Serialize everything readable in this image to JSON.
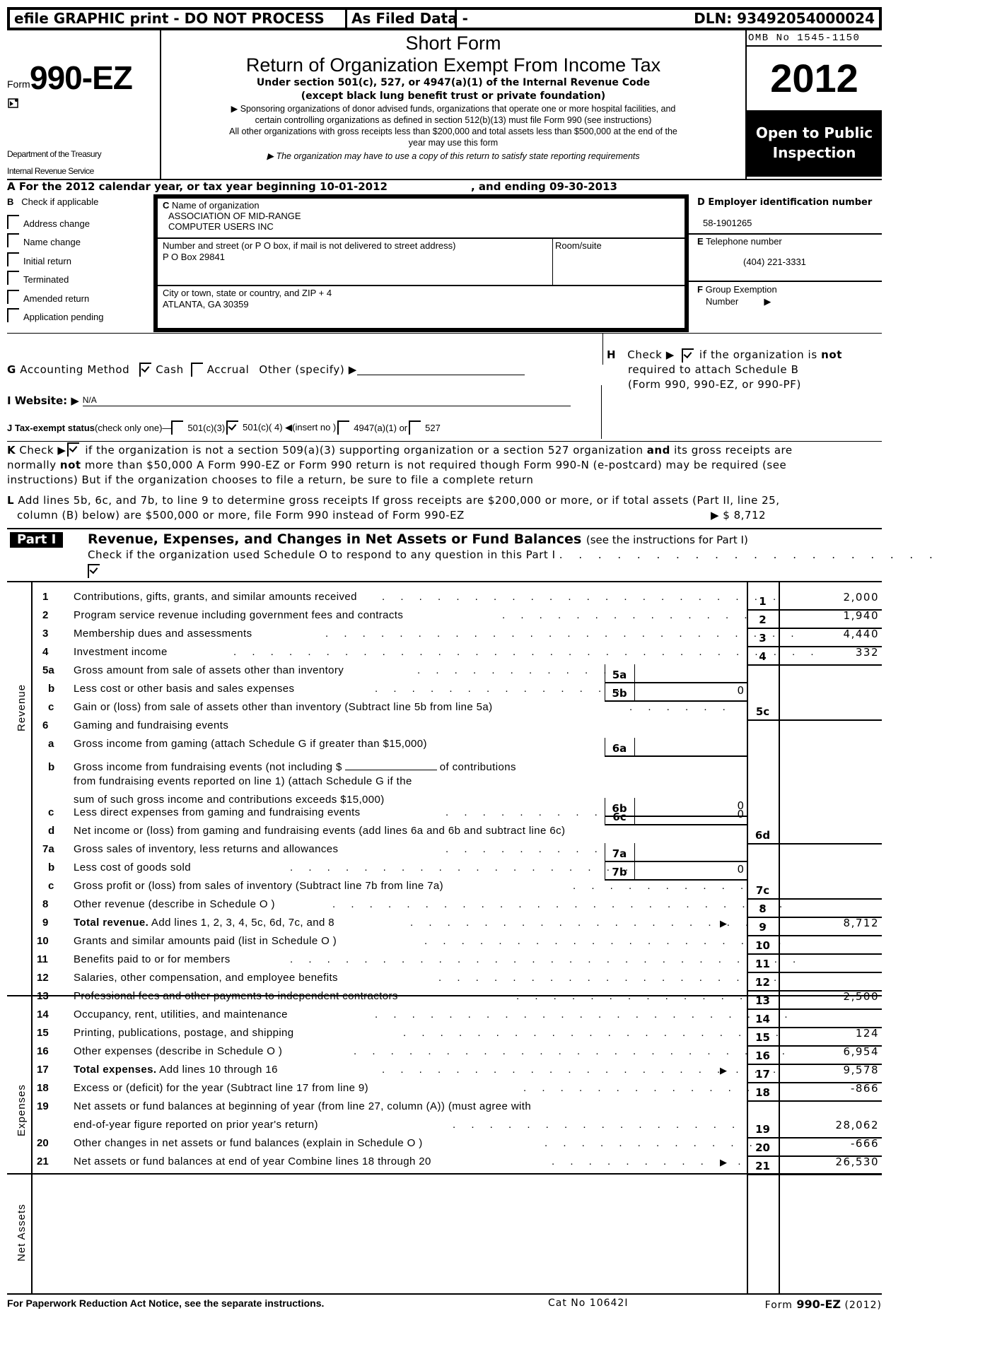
{
  "banner": {
    "efile": "efile GRAPHIC print - DO NOT PROCESS",
    "as_filed": "As Filed Data -",
    "dln": "DLN: 93492054000024"
  },
  "header": {
    "form_word": "Form",
    "form_number": "990-EZ",
    "form_icon": "efile-icon",
    "dept": "Department of the Treasury",
    "irs": "Internal Revenue Service",
    "short_form": "Short Form",
    "title": "Return of Organization Exempt From Income Tax",
    "subtitle1": "Under section 501(c), 527, or 4947(a)(1) of the Internal Revenue Code",
    "subtitle2": "(except black lung benefit trust or private foundation)",
    "note1": "▶ Sponsoring organizations of donor advised funds, organizations that operate one or more hospital facilities, and",
    "note2": "certain controlling organizations as defined in section 512(b)(13) must file Form 990 (see instructions)",
    "note3": "All other organizations with gross receipts less than $200,000 and total assets less than $500,000 at the end of the",
    "note4": "year may use this form",
    "note5": "▶ The organization may have to use a copy of this return to satisfy state reporting requirements",
    "omb": "OMB No 1545-1150",
    "year": "2012",
    "open_public": "Open to Public",
    "inspection": "Inspection"
  },
  "lineA": {
    "text": "A  For the 2012 calendar year, or tax year beginning 10-01-2012",
    "ending": ", and ending 09-30-2013"
  },
  "sectionB": {
    "title_letter": "B",
    "title": "Check if applicable",
    "items": [
      {
        "label": "Address change",
        "checked": false
      },
      {
        "label": "Name change",
        "checked": false
      },
      {
        "label": "Initial return",
        "checked": false
      },
      {
        "label": "Terminated",
        "checked": false
      },
      {
        "label": "Amended return",
        "checked": false
      },
      {
        "label": "Application pending",
        "checked": false
      }
    ]
  },
  "sectionC": {
    "name_label_letter": "C",
    "name_label": "Name of organization",
    "name_line1": "ASSOCIATION OF MID-RANGE",
    "name_line2": "COMPUTER USERS INC",
    "street_label": "Number and street (or P  O  box, if mail is not delivered to street address)",
    "street": "P O Box 29841",
    "room_label": "Room/suite",
    "city_label": "City or town, state or country, and ZIP + 4",
    "city": "ATLANTA, GA  30359"
  },
  "sectionD": {
    "label": "D Employer identification number",
    "ein": "58-1901265"
  },
  "sectionE": {
    "letter": "E",
    "label": "Telephone number",
    "phone": "(404) 221-3331"
  },
  "sectionF": {
    "letter": "F",
    "label1": "Group Exemption",
    "label2": "Number",
    "arrow": "▶"
  },
  "sectionG": {
    "letter": "G",
    "label": "Accounting Method",
    "cash": "Cash",
    "cash_checked": true,
    "accrual": "Accrual",
    "accrual_checked": false,
    "other": "Other (specify) ▶"
  },
  "sectionH": {
    "letter": "H",
    "check": "Check ▶",
    "checked": true,
    "text1": "if the organization is",
    "not": "not",
    "text2": "required to attach Schedule B",
    "text3": "(Form 990, 990-EZ, or 990-PF)"
  },
  "sectionI": {
    "label": "I Website: ▶",
    "value": "N/A"
  },
  "sectionJ": {
    "label": "J Tax-exempt status",
    "note": "(check only one)—",
    "opt1": "501(c)(3)",
    "opt1_checked": false,
    "opt2": "501(c)( 4) ◀(insert no )",
    "opt2_checked": true,
    "opt3": "4947(a)(1) or",
    "opt3_checked": false,
    "opt4": "527",
    "opt4_checked": false
  },
  "sectionK": {
    "letter": "K",
    "check": "Check ▶",
    "checked": true,
    "text1": "if the organization is not a section 509(a)(3) supporting organization or a section 527 organization",
    "and": "and",
    "text2": "its gross receipts are",
    "line2a": "normally",
    "not": "not",
    "line2b": "more than $50,000  A Form 990-EZ or Form 990 return is not required though Form 990-N (e-postcard) may be required (see",
    "line3": "instructions)  But if the organization chooses to file a return, be sure to file a complete return"
  },
  "sectionL": {
    "letter": "L",
    "line1": "Add lines 5b, 6c, and 7b, to line 9 to determine gross receipts  If gross receipts are $200,000 or more, or if total assets (Part II, line 25,",
    "line2": "column (B) below) are $500,000 or more, file Form 990 instead of Form 990-EZ",
    "amount": "▶ $ 8,712"
  },
  "partI": {
    "tag": "Part I",
    "title": "Revenue, Expenses, and Changes in Net Assets or Fund Balances",
    "title_note": "(see the instructions for Part I)",
    "schedule_o_text": "Check if the organization used Schedule O to respond to any question in this Part I",
    "schedule_o_checked": true
  },
  "side_labels": {
    "revenue": "Revenue",
    "expenses": "Expenses",
    "net_assets": "Net Assets"
  },
  "lines": {
    "l1": {
      "num": "1",
      "desc": "Contributions, gifts, grants, and similar amounts received",
      "col": "1",
      "value": "2,000"
    },
    "l2": {
      "num": "2",
      "desc": "Program service revenue including government fees and contracts",
      "col": "2",
      "value": "1,940"
    },
    "l3": {
      "num": "3",
      "desc": "Membership dues and assessments",
      "col": "3",
      "value": "4,440"
    },
    "l4": {
      "num": "4",
      "desc": "Investment income",
      "col": "4",
      "value": "332"
    },
    "l5a": {
      "num": "5a",
      "desc": "Gross amount from sale of assets other than inventory",
      "sub": "5a",
      "subvalue": ""
    },
    "l5b": {
      "num": "b",
      "desc": "Less  cost or other basis and sales expenses",
      "sub": "5b",
      "subvalue": "0"
    },
    "l5c": {
      "num": "c",
      "desc": "Gain or (loss) from sale of assets other than inventory (Subtract line 5b from line 5a)",
      "col": "5c",
      "value": ""
    },
    "l6": {
      "num": "6",
      "desc": "Gaming and fundraising events"
    },
    "l6a": {
      "num": "a",
      "desc": "Gross income from gaming (attach Schedule G if greater than $15,000)",
      "sub": "6a",
      "subvalue": ""
    },
    "l6b": {
      "num": "b",
      "desc1": "Gross income from fundraising events (not including $",
      "desc1b": "of contributions",
      "desc2": "from fundraising events reported on line 1) (attach Schedule G if the",
      "desc3": "sum of such gross income and contributions exceeds $15,000)",
      "sub": "6b",
      "subvalue": "0"
    },
    "l6c": {
      "num": "c",
      "desc": "Less  direct expenses from gaming and fundraising events",
      "sub": "6c",
      "subvalue": "0"
    },
    "l6d": {
      "num": "d",
      "desc": "Net income or (loss) from gaming and fundraising events (add lines 6a and 6b and subtract line 6c)",
      "col": "6d",
      "value": ""
    },
    "l7a": {
      "num": "7a",
      "desc": "Gross sales of inventory, less returns and allowances",
      "sub": "7a",
      "subvalue": ""
    },
    "l7b": {
      "num": "b",
      "desc": "Less  cost of goods sold",
      "sub": "7b",
      "subvalue": "0"
    },
    "l7c": {
      "num": "c",
      "desc": "Gross profit or (loss) from sales of inventory (Subtract line 7b from line 7a)",
      "col": "7c",
      "value": ""
    },
    "l8": {
      "num": "8",
      "desc": "Other revenue (describe in Schedule O )",
      "col": "8",
      "value": ""
    },
    "l9": {
      "num": "9",
      "desc_bold": "Total revenue.",
      "desc": " Add lines 1, 2, 3, 4, 5c, 6d, 7c, and 8",
      "col": "9",
      "value": "8,712"
    },
    "l10": {
      "num": "10",
      "desc": "Grants and similar amounts paid (list in Schedule O )",
      "col": "10",
      "value": ""
    },
    "l11": {
      "num": "11",
      "desc": "Benefits paid to or for members",
      "col": "11",
      "value": ""
    },
    "l12": {
      "num": "12",
      "desc": "Salaries, other compensation, and employee benefits",
      "col": "12",
      "value": ""
    },
    "l13": {
      "num": "13",
      "desc": "Professional fees and other payments to independent contractors",
      "col": "13",
      "value": "2,500"
    },
    "l14": {
      "num": "14",
      "desc": "Occupancy, rent, utilities, and maintenance",
      "col": "14",
      "value": ""
    },
    "l15": {
      "num": "15",
      "desc": "Printing, publications, postage, and shipping",
      "col": "15",
      "value": "124"
    },
    "l16": {
      "num": "16",
      "desc": "Other expenses (describe in Schedule O )",
      "col": "16",
      "value": "6,954"
    },
    "l17": {
      "num": "17",
      "desc_bold": "Total expenses.",
      "desc": " Add lines 10 through 16",
      "col": "17",
      "value": "9,578"
    },
    "l18": {
      "num": "18",
      "desc": "Excess or (deficit) for the year (Subtract line 17 from line 9)",
      "col": "18",
      "value": "-866"
    },
    "l19": {
      "num": "19",
      "desc1": "Net assets or fund balances at beginning of year (from line 27, column (A)) (must agree with",
      "desc2": "end-of-year figure reported on prior year's return)",
      "col": "19",
      "value": "28,062"
    },
    "l20": {
      "num": "20",
      "desc": "Other changes in net assets or fund balances (explain in Schedule O )",
      "col": "20",
      "value": "-666"
    },
    "l21": {
      "num": "21",
      "desc": "Net assets or fund balances at end of year  Combine lines 18 through 20",
      "col": "21",
      "value": "26,530"
    }
  },
  "footer": {
    "paperwork": "For Paperwork Reduction Act Notice, see the separate instructions.",
    "cat": "Cat No 10642I",
    "form_word": "Form",
    "form_number": "990-EZ",
    "form_year": "(2012)"
  }
}
